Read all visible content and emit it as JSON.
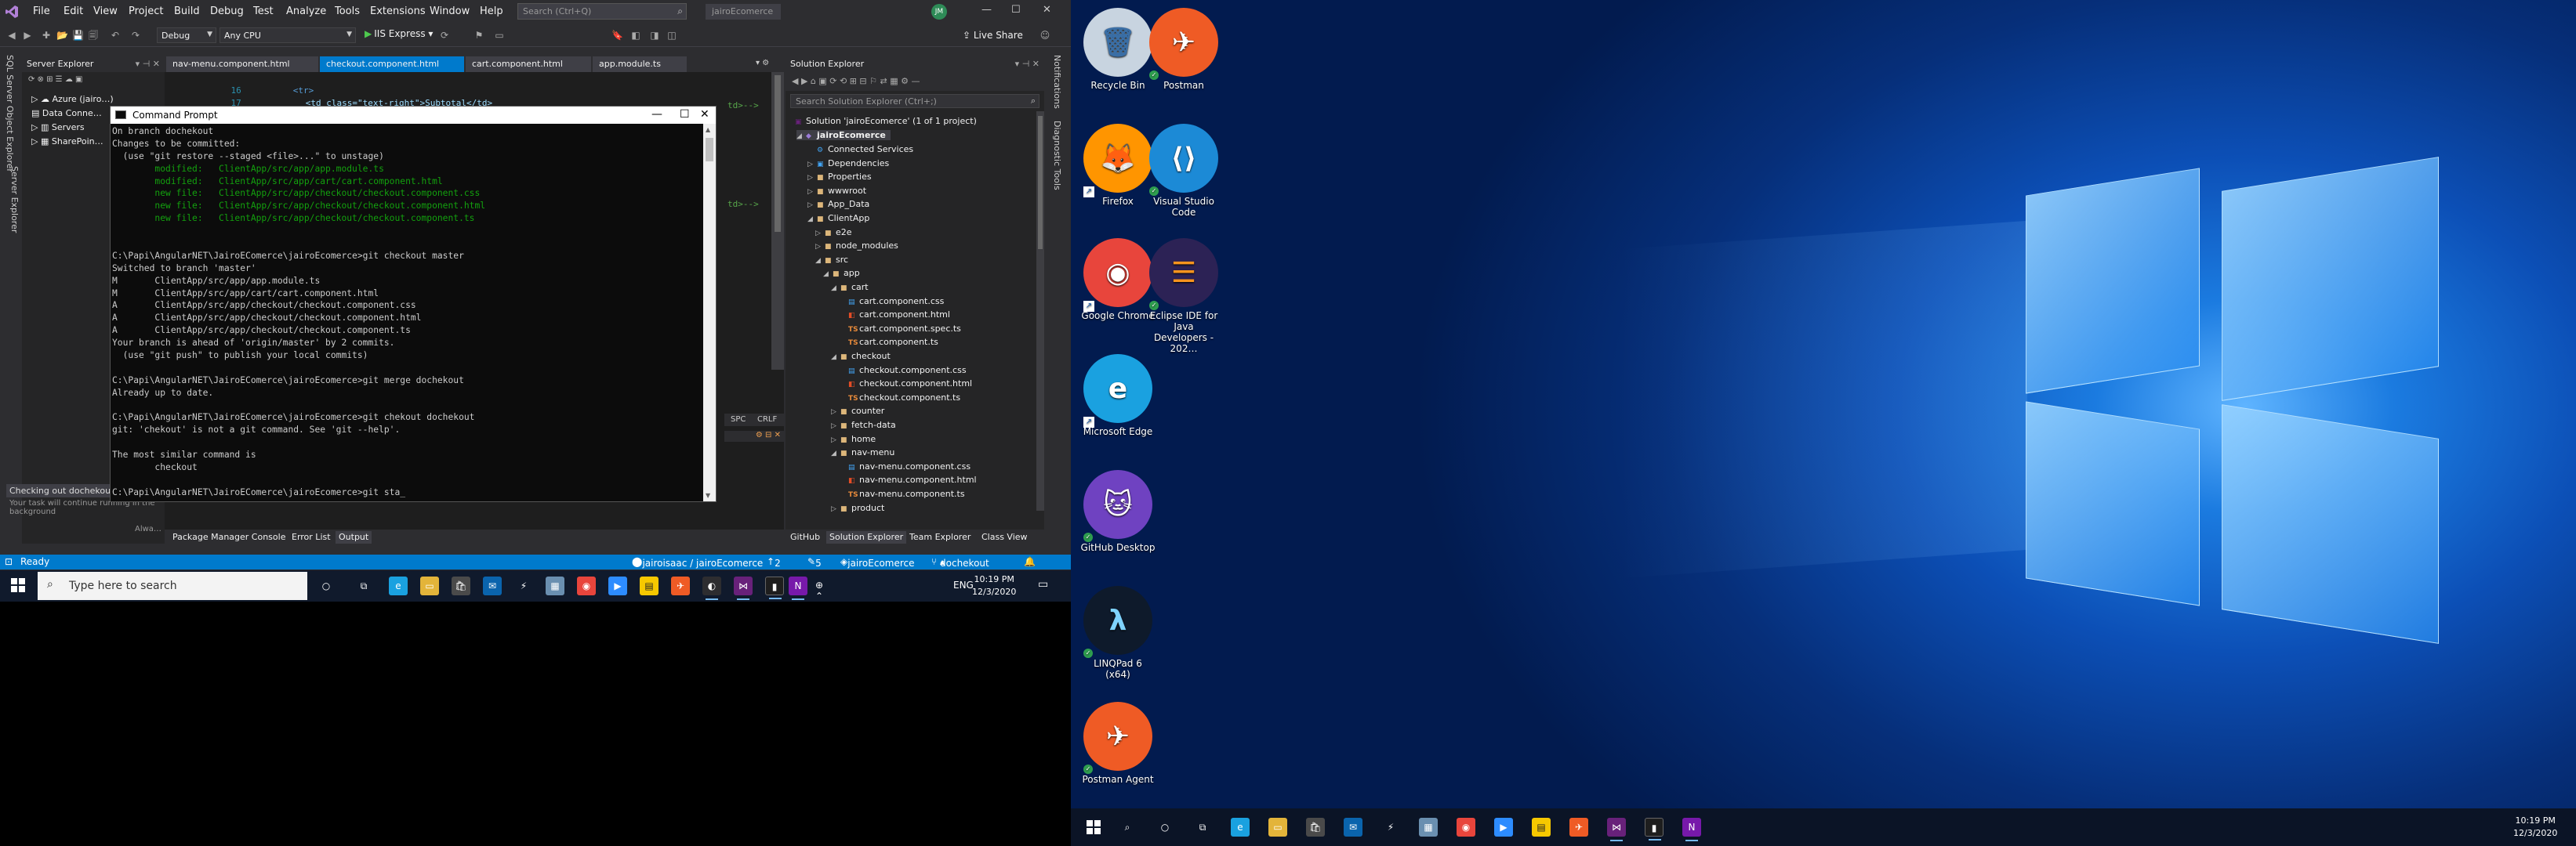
{
  "vs": {
    "menu": [
      "File",
      "Edit",
      "View",
      "Project",
      "Build",
      "Debug",
      "Test",
      "Analyze",
      "Tools",
      "Extensions",
      "Window",
      "Help"
    ],
    "search_placeholder": "Search (Ctrl+Q)",
    "solution_name": "jairoEcomerce",
    "avatar_initials": "JM",
    "toolbar": {
      "config": "Debug",
      "platform": "Any CPU",
      "run_target": "IIS Express",
      "live_share": "Live Share"
    },
    "left_vertical_tabs": [
      "SQL Server Object Explorer",
      "Server Explorer"
    ],
    "right_vertical_tabs": [
      "Notifications",
      "Diagnostic Tools"
    ],
    "server_explorer": {
      "title": "Server Explorer",
      "items": [
        "Azure (jairo…)",
        "Data Conne…",
        "Servers",
        "SharePoin…"
      ]
    },
    "doc_tabs": [
      "nav-menu.component.html",
      "checkout.component.html",
      "cart.component.html",
      "app.module.ts"
    ],
    "code": [
      {
        "ln": "16",
        "text": "<tr>"
      },
      {
        "ln": "17",
        "text": "<td class=\"text-right\">Subtotal</td>"
      }
    ],
    "editor_frag": {
      "a": "td>-->",
      "b": "td>-->",
      "spc": "SPC",
      "crlf": "CRLF"
    },
    "solution_explorer": {
      "title": "Solution Explorer",
      "search_placeholder": "Search Solution Explorer (Ctrl+;)",
      "root": "Solution 'jairoEcomerce' (1 of 1 project)",
      "project": "jairoEcomerce",
      "nodes": [
        {
          "label": "Connected Services",
          "depth": 2,
          "kind": "svc"
        },
        {
          "label": "Dependencies",
          "depth": 2,
          "kind": "dep"
        },
        {
          "label": "Properties",
          "depth": 2,
          "kind": "folder"
        },
        {
          "label": "wwwroot",
          "depth": 2,
          "kind": "folder"
        },
        {
          "label": "App_Data",
          "depth": 2,
          "kind": "folder"
        },
        {
          "label": "ClientApp",
          "depth": 2,
          "kind": "folder"
        },
        {
          "label": "e2e",
          "depth": 3,
          "kind": "folder"
        },
        {
          "label": "node_modules",
          "depth": 3,
          "kind": "folder"
        },
        {
          "label": "src",
          "depth": 3,
          "kind": "folder"
        },
        {
          "label": "app",
          "depth": 4,
          "kind": "folder"
        },
        {
          "label": "cart",
          "depth": 5,
          "kind": "folder"
        },
        {
          "label": "cart.component.css",
          "depth": 6,
          "kind": "css"
        },
        {
          "label": "cart.component.html",
          "depth": 6,
          "kind": "html"
        },
        {
          "label": "cart.component.spec.ts",
          "depth": 6,
          "kind": "ts"
        },
        {
          "label": "cart.component.ts",
          "depth": 6,
          "kind": "ts"
        },
        {
          "label": "checkout",
          "depth": 5,
          "kind": "folder"
        },
        {
          "label": "checkout.component.css",
          "depth": 6,
          "kind": "css"
        },
        {
          "label": "checkout.component.html",
          "depth": 6,
          "kind": "html"
        },
        {
          "label": "checkout.component.ts",
          "depth": 6,
          "kind": "ts"
        },
        {
          "label": "counter",
          "depth": 5,
          "kind": "folder"
        },
        {
          "label": "fetch-data",
          "depth": 5,
          "kind": "folder"
        },
        {
          "label": "home",
          "depth": 5,
          "kind": "folder"
        },
        {
          "label": "nav-menu",
          "depth": 5,
          "kind": "folder"
        },
        {
          "label": "nav-menu.component.css",
          "depth": 6,
          "kind": "css"
        },
        {
          "label": "nav-menu.component.html",
          "depth": 6,
          "kind": "html"
        },
        {
          "label": "nav-menu.component.ts",
          "depth": 6,
          "kind": "ts"
        },
        {
          "label": "product",
          "depth": 5,
          "kind": "folder"
        }
      ],
      "bottom_tabs": [
        "GitHub",
        "Solution Explorer",
        "Team Explorer",
        "Class View"
      ]
    },
    "bottom_tool_tabs": [
      "Package Manager Console",
      "Error List",
      "Output"
    ],
    "status": {
      "ready": "Ready",
      "repo": "jairoisaac / jairoEcomerce",
      "up_count": "2",
      "edit_count": "5",
      "project": "jairoEcomerce",
      "branch": "dochekout"
    },
    "toast": {
      "title": "Checking out dochekout branch",
      "body": "Your task will continue running in the background",
      "always": "Alwa…"
    }
  },
  "cmd": {
    "title": "Command Prompt",
    "lines": [
      {
        "t": "On branch dochekout",
        "c": "n"
      },
      {
        "t": "Changes to be committed:",
        "c": "n"
      },
      {
        "t": "  (use \"git restore --staged <file>...\" to unstage)",
        "c": "n"
      },
      {
        "t": "        modified:   ClientApp/src/app/app.module.ts",
        "c": "g"
      },
      {
        "t": "        modified:   ClientApp/src/app/cart/cart.component.html",
        "c": "g"
      },
      {
        "t": "        new file:   ClientApp/src/app/checkout/checkout.component.css",
        "c": "g"
      },
      {
        "t": "        new file:   ClientApp/src/app/checkout/checkout.component.html",
        "c": "g"
      },
      {
        "t": "        new file:   ClientApp/src/app/checkout/checkout.component.ts",
        "c": "g"
      },
      {
        "t": "",
        "c": "n"
      },
      {
        "t": "",
        "c": "n"
      },
      {
        "t": "C:\\Papi\\AngularNET\\JairoEComerce\\jairoEcomerce>git checkout master",
        "c": "n"
      },
      {
        "t": "Switched to branch 'master'",
        "c": "n"
      },
      {
        "t": "M       ClientApp/src/app/app.module.ts",
        "c": "n"
      },
      {
        "t": "M       ClientApp/src/app/cart/cart.component.html",
        "c": "n"
      },
      {
        "t": "A       ClientApp/src/app/checkout/checkout.component.css",
        "c": "n"
      },
      {
        "t": "A       ClientApp/src/app/checkout/checkout.component.html",
        "c": "n"
      },
      {
        "t": "A       ClientApp/src/app/checkout/checkout.component.ts",
        "c": "n"
      },
      {
        "t": "Your branch is ahead of 'origin/master' by 2 commits.",
        "c": "n"
      },
      {
        "t": "  (use \"git push\" to publish your local commits)",
        "c": "n"
      },
      {
        "t": "",
        "c": "n"
      },
      {
        "t": "C:\\Papi\\AngularNET\\JairoEComerce\\jairoEcomerce>git merge dochekout",
        "c": "n"
      },
      {
        "t": "Already up to date.",
        "c": "n"
      },
      {
        "t": "",
        "c": "n"
      },
      {
        "t": "C:\\Papi\\AngularNET\\JairoEComerce\\jairoEcomerce>git chekout dochekout",
        "c": "n"
      },
      {
        "t": "git: 'chekout' is not a git command. See 'git --help'.",
        "c": "n"
      },
      {
        "t": "",
        "c": "n"
      },
      {
        "t": "The most similar command is",
        "c": "n"
      },
      {
        "t": "        checkout",
        "c": "n"
      },
      {
        "t": "",
        "c": "n"
      },
      {
        "t": "C:\\Papi\\AngularNET\\JairoEComerce\\jairoEcomerce>git sta_",
        "c": "n"
      }
    ]
  },
  "taskbar": {
    "search_placeholder": "Type here to search",
    "lang": "ENG",
    "time": "10:19 PM",
    "date": "12/3/2020"
  },
  "desktop": {
    "icons": [
      {
        "label": "Recycle Bin",
        "name": "recycle-bin-icon",
        "glyph": "🗑",
        "bg": "#c8d4e0",
        "fg": "#3a6ea5",
        "badge": "none"
      },
      {
        "label": "Postman",
        "name": "postman-icon",
        "glyph": "✈",
        "bg": "#ef5b25",
        "fg": "#fff",
        "badge": "check"
      },
      {
        "label": "Firefox",
        "name": "firefox-icon",
        "glyph": "🦊",
        "bg": "#ff9500",
        "fg": "#fff",
        "badge": "shortcut"
      },
      {
        "label": "Visual Studio Code",
        "name": "vscode-icon",
        "glyph": "⟨⟩",
        "bg": "#1c8ad6",
        "fg": "#fff",
        "badge": "check"
      },
      {
        "label": "Google Chrome",
        "name": "chrome-icon",
        "glyph": "◉",
        "bg": "#e8453c",
        "fg": "#fff",
        "badge": "shortcut"
      },
      {
        "label": "Eclipse IDE for Java Developers - 202…",
        "name": "eclipse-icon",
        "glyph": "☰",
        "bg": "#2c2255",
        "fg": "#f7941e",
        "badge": "check"
      },
      {
        "label": "Microsoft Edge",
        "name": "edge-icon",
        "glyph": "e",
        "bg": "#1aa1e0",
        "fg": "#fff",
        "badge": "shortcut"
      },
      {
        "label": "GitHub Desktop",
        "name": "github-desktop-icon",
        "glyph": "🐱",
        "bg": "#6f42c1",
        "fg": "#fff",
        "badge": "check"
      },
      {
        "label": "LINQPad 6 (x64)",
        "name": "linqpad-icon",
        "glyph": "λ",
        "bg": "#0e1a2b",
        "fg": "#7fd3ff",
        "badge": "check"
      },
      {
        "label": "Postman Agent",
        "name": "postman-agent-icon",
        "glyph": "✈",
        "bg": "#ef5b25",
        "fg": "#fff",
        "badge": "check"
      }
    ]
  }
}
